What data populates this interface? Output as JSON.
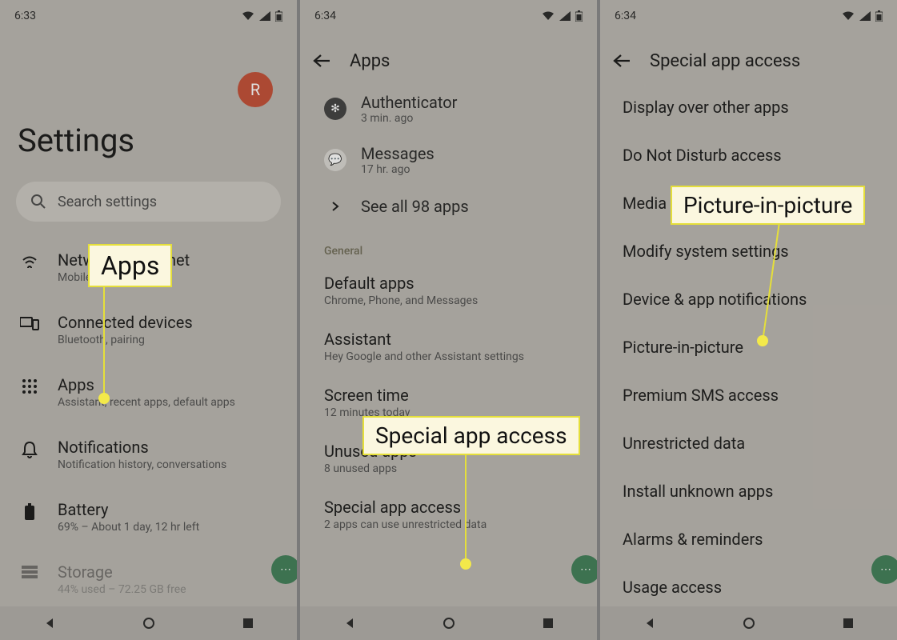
{
  "panel1": {
    "time": "6:33",
    "avatar_letter": "R",
    "heading": "Settings",
    "search_placeholder": "Search settings",
    "items": [
      {
        "title": "Network & internet",
        "sub": "Mobile"
      },
      {
        "title": "Connected devices",
        "sub": "Bluetooth, pairing"
      },
      {
        "title": "Apps",
        "sub": "Assistant, recent apps, default apps"
      },
      {
        "title": "Notifications",
        "sub": "Notification history, conversations"
      },
      {
        "title": "Battery",
        "sub": "69% – About 1 day, 12 hr left"
      },
      {
        "title": "Storage",
        "sub": "44% used – 72.25 GB free"
      }
    ],
    "callout": "Apps"
  },
  "panel2": {
    "time": "6:34",
    "appbar_title": "Apps",
    "recent": [
      {
        "title": "Authenticator",
        "sub": "3 min. ago"
      },
      {
        "title": "Messages",
        "sub": "17 hr. ago"
      }
    ],
    "see_all": "See all 98 apps",
    "section": "General",
    "general": [
      {
        "title": "Default apps",
        "sub": "Chrome, Phone, and Messages"
      },
      {
        "title": "Assistant",
        "sub": "Hey Google and other Assistant settings"
      },
      {
        "title": "Screen time",
        "sub": "12 minutes today"
      },
      {
        "title": "Unused apps",
        "sub": "8 unused apps"
      },
      {
        "title": "Special app access",
        "sub": "2 apps can use unrestricted data"
      }
    ],
    "callout": "Special app access"
  },
  "panel3": {
    "time": "6:34",
    "appbar_title": "Special app access",
    "items": [
      "Display over other apps",
      "Do Not Disturb access",
      "Media management apps",
      "Modify system settings",
      "Device & app notifications",
      "Picture-in-picture",
      "Premium SMS access",
      "Unrestricted data",
      "Install unknown apps",
      "Alarms & reminders",
      "Usage access"
    ],
    "callout": "Picture-in-picture"
  }
}
